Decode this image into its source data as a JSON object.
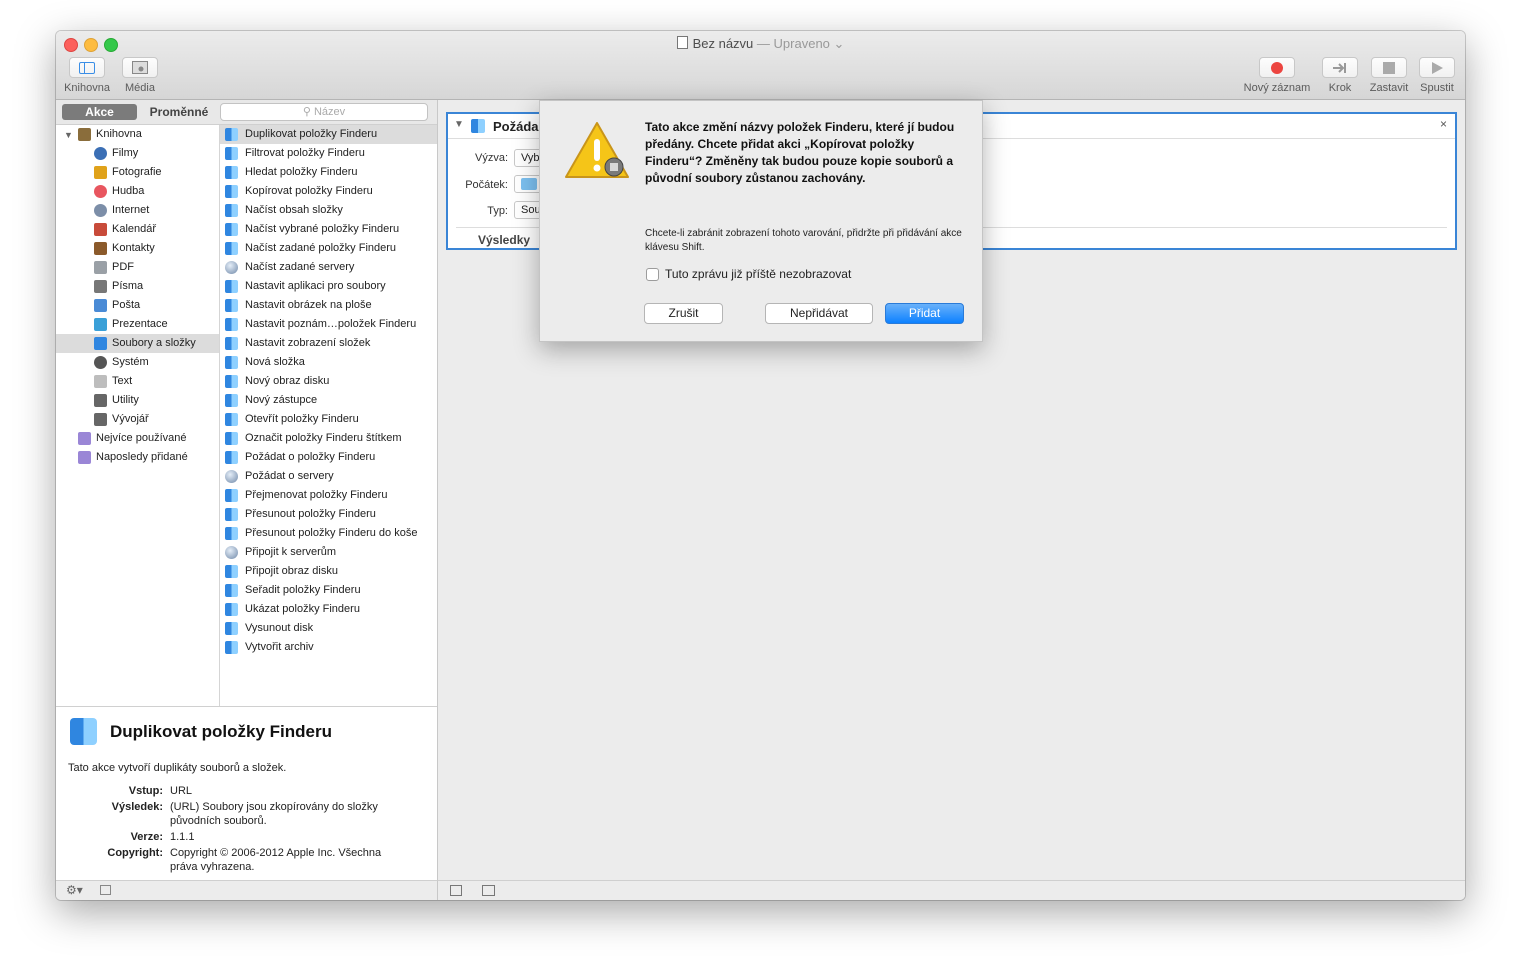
{
  "window": {
    "title": "Bez názvu",
    "title_separator": "—",
    "title_status": "Upraveno"
  },
  "toolbar": {
    "library_label": "Knihovna",
    "media_label": "Média",
    "record_label": "Nový záznam",
    "step_label": "Krok",
    "stop_label": "Zastavit",
    "run_label": "Spustit"
  },
  "sidebar": {
    "tab_actions": "Akce",
    "tab_variables": "Proměnné",
    "search_placeholder": "Název",
    "categories": [
      {
        "label": "Knihovna",
        "icon": "library-icon",
        "selected": false
      },
      {
        "label": "Filmy",
        "icon": "movies-icon",
        "selected": false
      },
      {
        "label": "Fotografie",
        "icon": "photos-icon",
        "selected": false
      },
      {
        "label": "Hudba",
        "icon": "music-icon",
        "selected": false
      },
      {
        "label": "Internet",
        "icon": "internet-icon",
        "selected": false
      },
      {
        "label": "Kalendář",
        "icon": "calendar-icon",
        "selected": false
      },
      {
        "label": "Kontakty",
        "icon": "contacts-icon",
        "selected": false
      },
      {
        "label": "PDF",
        "icon": "pdf-icon",
        "selected": false
      },
      {
        "label": "Písma",
        "icon": "fonts-icon",
        "selected": false
      },
      {
        "label": "Pošta",
        "icon": "mail-icon",
        "selected": false
      },
      {
        "label": "Prezentace",
        "icon": "presentation-icon",
        "selected": false
      },
      {
        "label": "Soubory a složky",
        "icon": "finder-icon",
        "selected": true
      },
      {
        "label": "Systém",
        "icon": "system-icon",
        "selected": false
      },
      {
        "label": "Text",
        "icon": "text-icon",
        "selected": false
      },
      {
        "label": "Utility",
        "icon": "utility-icon",
        "selected": false
      },
      {
        "label": "Vývojář",
        "icon": "developer-icon",
        "selected": false
      },
      {
        "label": "Nejvíce používané",
        "icon": "smart-folder-icon",
        "selected": false
      },
      {
        "label": "Naposledy přidané",
        "icon": "smart-folder-icon",
        "selected": false
      }
    ],
    "actions": [
      {
        "label": "Duplikovat položky Finderu",
        "icon": "finder-icon"
      },
      {
        "label": "Filtrovat položky Finderu",
        "icon": "finder-icon"
      },
      {
        "label": "Hledat položky Finderu",
        "icon": "finder-icon"
      },
      {
        "label": "Kopírovat položky Finderu",
        "icon": "finder-icon"
      },
      {
        "label": "Načíst obsah složky",
        "icon": "finder-icon"
      },
      {
        "label": "Načíst vybrané položky Finderu",
        "icon": "finder-icon"
      },
      {
        "label": "Načíst zadané položky Finderu",
        "icon": "finder-icon"
      },
      {
        "label": "Načíst zadané servery",
        "icon": "globe-icon"
      },
      {
        "label": "Nastavit aplikaci pro soubory",
        "icon": "finder-icon"
      },
      {
        "label": "Nastavit obrázek na ploše",
        "icon": "finder-icon"
      },
      {
        "label": "Nastavit poznám…položek Finderu",
        "icon": "finder-icon"
      },
      {
        "label": "Nastavit zobrazení složek",
        "icon": "finder-icon"
      },
      {
        "label": "Nová složka",
        "icon": "finder-icon"
      },
      {
        "label": "Nový obraz disku",
        "icon": "finder-icon"
      },
      {
        "label": "Nový zástupce",
        "icon": "finder-icon"
      },
      {
        "label": "Otevřít položky Finderu",
        "icon": "finder-icon"
      },
      {
        "label": "Označit položky Finderu štítkem",
        "icon": "finder-icon"
      },
      {
        "label": "Požádat o položky Finderu",
        "icon": "finder-icon"
      },
      {
        "label": "Požádat o servery",
        "icon": "globe-icon"
      },
      {
        "label": "Přejmenovat položky Finderu",
        "icon": "finder-icon"
      },
      {
        "label": "Přesunout položky Finderu",
        "icon": "finder-icon"
      },
      {
        "label": "Přesunout položky Finderu do koše",
        "icon": "finder-icon"
      },
      {
        "label": "Připojit k serverům",
        "icon": "globe-icon"
      },
      {
        "label": "Připojit obraz disku",
        "icon": "finder-icon"
      },
      {
        "label": "Seřadit položky Finderu",
        "icon": "finder-icon"
      },
      {
        "label": "Ukázat položky Finderu",
        "icon": "finder-icon"
      },
      {
        "label": "Vysunout disk",
        "icon": "finder-icon"
      },
      {
        "label": "Vytvořit archiv",
        "icon": "finder-icon"
      }
    ]
  },
  "description": {
    "title": "Duplikovat položky Finderu",
    "summary": "Tato akce vytvoří duplikáty souborů a složek.",
    "input_label": "Vstup:",
    "input_value": "URL",
    "result_label": "Výsledek:",
    "result_value": "(URL) Soubory jsou zkopírovány do složky původních souborů.",
    "version_label": "Verze:",
    "version_value": "1.1.1",
    "copyright_label": "Copyright:",
    "copyright_value": "Copyright © 2006-2012 Apple Inc. Všechna práva vyhrazena."
  },
  "workflow": {
    "action_title": "Požáda",
    "prompt_label": "Výzva:",
    "prompt_value": "Vyb",
    "start_label": "Počátek:",
    "type_label": "Typ:",
    "type_value": "Sou",
    "results_label": "Výsledky",
    "close_glyph": "×"
  },
  "alert": {
    "message": "Tato akce změní názvy položek Finderu, které jí budou předány. Chcete přidat akci „Kopírovat položky Finderu“? Změněny tak budou pouze kopie souborů a původní soubory zůstanou zachovány.",
    "info": "Chcete-li zabránit zobrazení tohoto varování, přidržte při přidávání akce klávesu Shift.",
    "suppress_label": "Tuto zprávu již příště nezobrazovat",
    "suppress_checked": false,
    "cancel_label": "Zrušit",
    "dont_add_label": "Nepřidávat",
    "add_label": "Přidat"
  },
  "colors": {
    "accent": "#1a82fb",
    "selection_bg": "#dcdcdc",
    "record_red": "#ec4540"
  }
}
